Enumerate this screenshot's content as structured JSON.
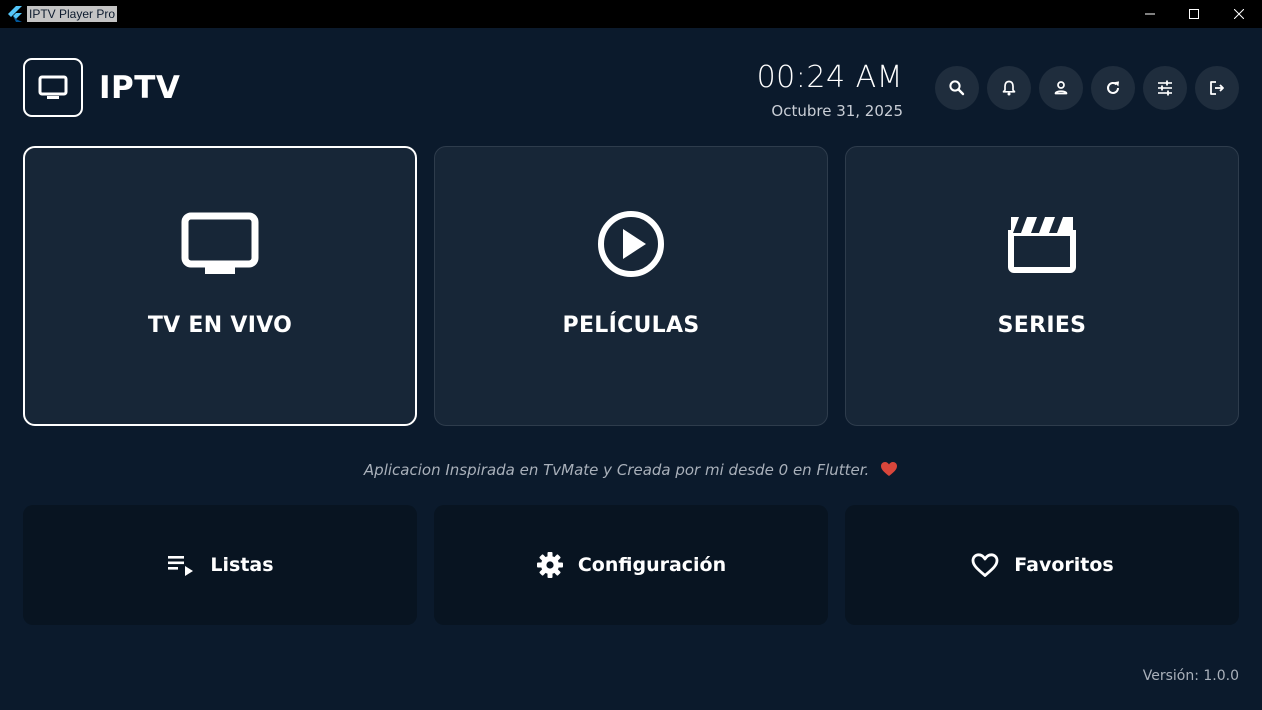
{
  "window": {
    "title": "IPTV Player Pro",
    "app_icon": "flutter-icon"
  },
  "header": {
    "logo_icon": "tv-icon",
    "app_name": "IPTV",
    "time": "00:24 AM",
    "date": "Octubre 31, 2025",
    "actions": [
      {
        "icon": "search-icon"
      },
      {
        "icon": "bell-icon"
      },
      {
        "icon": "user-icon"
      },
      {
        "icon": "refresh-icon"
      },
      {
        "icon": "sliders-icon"
      },
      {
        "icon": "logout-icon"
      }
    ]
  },
  "cards": [
    {
      "label": "TV EN VIVO",
      "icon": "tv-icon",
      "selected": true
    },
    {
      "label": "PELÍCULAS",
      "icon": "play-circle-icon",
      "selected": false
    },
    {
      "label": "SERIES",
      "icon": "clapperboard-icon",
      "selected": false
    }
  ],
  "tagline": "Aplicacion Inspirada en TvMate y Creada por mi desde 0 en Flutter.",
  "bottom_buttons": [
    {
      "label": "Listas",
      "icon": "playlist-icon"
    },
    {
      "label": "Configuración",
      "icon": "gear-icon"
    },
    {
      "label": "Favoritos",
      "icon": "heart-outline-icon"
    }
  ],
  "version": "Versión: 1.0.0",
  "colors": {
    "background": "#0b1a2c",
    "card": "#172637",
    "button": "#081421",
    "heart": "#d9463b"
  }
}
